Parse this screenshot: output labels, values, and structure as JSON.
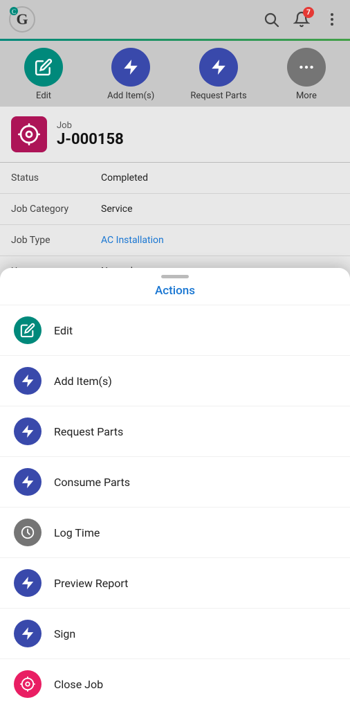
{
  "app": {
    "logo_text": "G",
    "notification_count": "7"
  },
  "toolbar": {
    "edit_label": "Edit",
    "add_items_label": "Add Item(s)",
    "request_parts_label": "Request Parts",
    "more_label": "More"
  },
  "job": {
    "subtitle": "Job",
    "id": "J-000158",
    "status_label": "Status",
    "status_value": "Completed",
    "category_label": "Job Category",
    "category_value": "Service",
    "type_label": "Job Type",
    "type_value": "AC Installation",
    "urgency_label": "Urgency",
    "urgency_value": "Normal"
  },
  "actions_sheet": {
    "title": "Actions",
    "handle_label": "",
    "items": [
      {
        "label": "Edit",
        "icon_type": "pencil",
        "color_class": "action-green"
      },
      {
        "label": "Add Item(s)",
        "icon_type": "bolt",
        "color_class": "action-purple"
      },
      {
        "label": "Request Parts",
        "icon_type": "bolt",
        "color_class": "action-purple"
      },
      {
        "label": "Consume Parts",
        "icon_type": "bolt",
        "color_class": "action-purple"
      },
      {
        "label": "Log Time",
        "icon_type": "clock",
        "color_class": "action-gray"
      },
      {
        "label": "Preview Report",
        "icon_type": "bolt",
        "color_class": "action-purple"
      },
      {
        "label": "Sign",
        "icon_type": "bolt",
        "color_class": "action-purple"
      },
      {
        "label": "Close Job",
        "icon_type": "alarm",
        "color_class": "action-pink"
      }
    ]
  }
}
